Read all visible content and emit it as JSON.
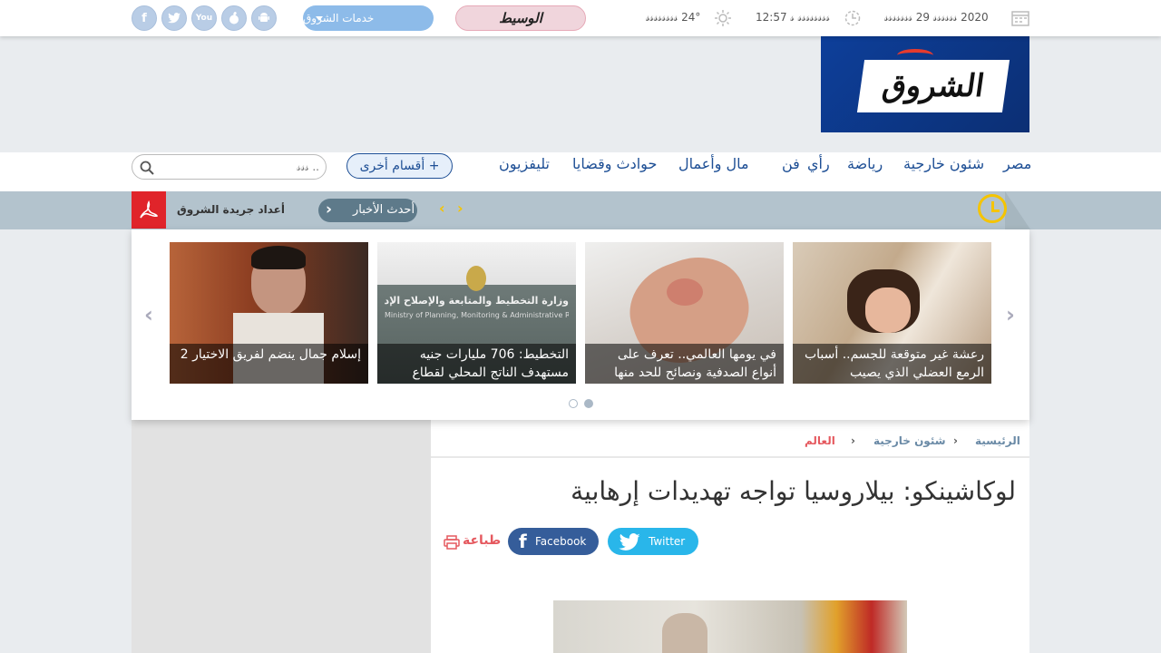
{
  "topbar": {
    "date": "𝓈𝓈𝓈𝓈𝓈𝓈𝓈 29 𝓈𝓈𝓈𝓈𝓈𝓈 2020",
    "time": "12:57 𝓈 𝓈𝓈𝓈𝓈𝓈𝓈𝓈𝓈",
    "weather": "𝓈𝓈𝓈𝓈𝓈𝓈𝓈𝓈 24°",
    "wasat_logo": "الوسيط",
    "services_label": "خدمات الشروق",
    "social": [
      "android-icon",
      "apple-icon",
      "youtube-icon",
      "twitter-icon",
      "facebook-icon"
    ]
  },
  "header": {
    "logo_text": "الشروق"
  },
  "nav": {
    "items": [
      "مصر",
      "شئون خارجية",
      "رياضة",
      "رأي",
      "فن",
      "مال وأعمال",
      "حوادث وقضايا",
      "تليفزيون"
    ],
    "more_label": "+ أقسام أخرى",
    "search_placeholder": "𝓈𝓈𝓈 .."
  },
  "ticker": {
    "newspaper_issues": "أعداد جريدة الشروق",
    "latest_news": "أحدث الأخبار"
  },
  "carousel": {
    "cards": [
      {
        "caption": "رعشة غير متوقعة للجسم.. أسباب الرمع العضلي الذي يصيب"
      },
      {
        "caption": "في يومها العالمي.. تعرف على أنواع الصدفية ونصائح للحد منها"
      },
      {
        "caption": "التخطيط: 706 مليارات جنيه مستهدف الناتج المحلي لقطاع"
      },
      {
        "caption": "إسلام جمال ينضم لفريق الاختيار 2"
      }
    ],
    "sign_text": "وزارة التخطيط والمتابعة والإصلاح الإداري",
    "sign_text_en": "Ministry of Planning, Monitoring & Administrative Reform"
  },
  "breadcrumb": {
    "home": "الرئيسية",
    "section": "شئون خارجية",
    "current": "العالم"
  },
  "article": {
    "title": "لوكاشينكو: بيلاروسيا تواجه تهديدات إرهابية",
    "twitter_label": "Twitter",
    "facebook_label": "Facebook",
    "print_label": "طباعة"
  },
  "colors": {
    "brand_blue": "#1e4f95",
    "accent_red": "#e0242a",
    "ticker_bg": "#b3c3cd"
  }
}
